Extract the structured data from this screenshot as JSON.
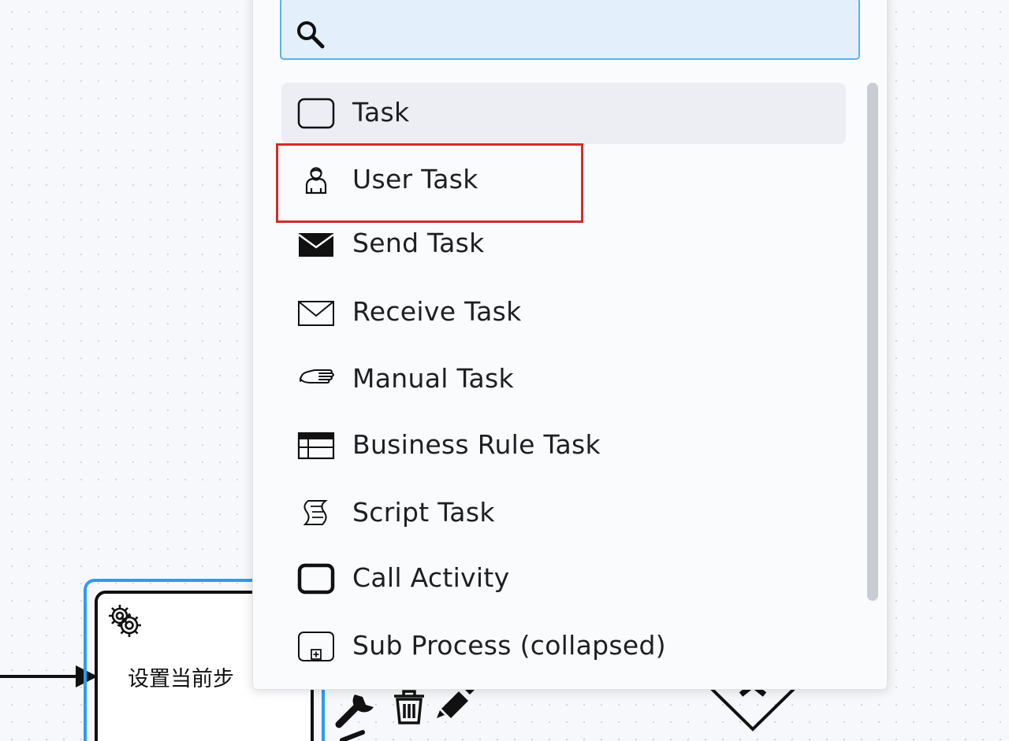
{
  "canvas": {
    "task_label": "设置当前步",
    "selection_color": "#2d9cf0"
  },
  "popup": {
    "search": {
      "value": "",
      "placeholder": ""
    },
    "entries": [
      {
        "label": "Task",
        "icon": "task-icon"
      },
      {
        "label": "User Task",
        "icon": "user-task-icon"
      },
      {
        "label": "Send Task",
        "icon": "send-task-icon"
      },
      {
        "label": "Receive Task",
        "icon": "receive-task-icon"
      },
      {
        "label": "Manual Task",
        "icon": "manual-task-icon"
      },
      {
        "label": "Business Rule Task",
        "icon": "business-rule-task-icon"
      },
      {
        "label": "Script Task",
        "icon": "script-task-icon"
      },
      {
        "label": "Call Activity",
        "icon": "call-activity-icon"
      },
      {
        "label": "Sub Process (collapsed)",
        "icon": "sub-process-collapsed-icon"
      }
    ],
    "active_entry": "Task",
    "highlighted_entry": "User Task",
    "highlight_color": "#d62a2a"
  }
}
